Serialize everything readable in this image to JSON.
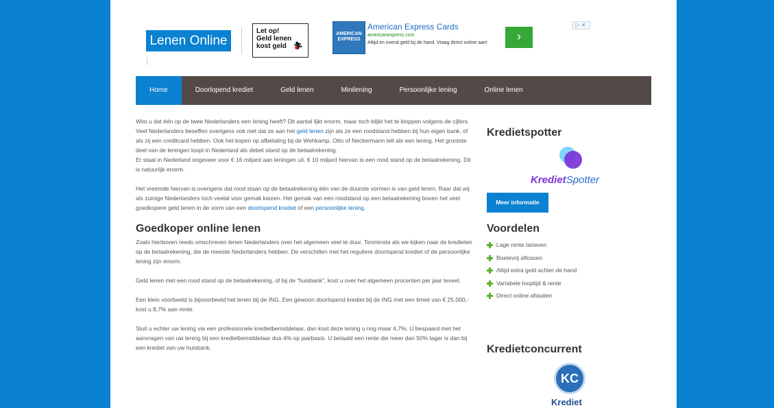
{
  "header": {
    "logo_text": "Lenen Online",
    "warning": {
      "line1": "Let op!",
      "line2": "Geld lenen",
      "line3": "kost geld"
    }
  },
  "ad": {
    "logo_line1": "AMERICAN",
    "logo_line2": "EXPRESS",
    "title": "American Express Cards",
    "url": "americanexpress.com",
    "text": "Altijd en overal geld bij de hand. Vraag direct online aan!",
    "arrow": "›",
    "choices": "▷✕"
  },
  "nav": {
    "items": [
      {
        "label": "Home",
        "active": true
      },
      {
        "label": "Doorlopend krediet"
      },
      {
        "label": "Geld lenen"
      },
      {
        "label": "Minilening"
      },
      {
        "label": "Persoonlijke lening"
      },
      {
        "label": "Online lenen"
      }
    ]
  },
  "main": {
    "p1": {
      "t1": "Wist u dat één op de twee Nederlanders een lening heeft? Dit aantal lijkt enorm, maar toch blijkt het te kloppen volgens de cijfers. Veel Nederlanders beseffen overigens ook niet dat ze aan het ",
      "link1": "geld lenen",
      "t2": " zijn als ze een roodstand hebben bij hun eigen bank, of als zij een creditcard hebben. Ook het kopen op afbetaling bij de Wehkamp, Otto of Neckermann telt als een lening. Het grootste deel van de leningen loopt in Nederland als debet stand op de betaalrekening."
    },
    "p2": "Er staat in Nederland ongeveer voor € 16 miljard aan leningen uit. € 10 miljard hiervan is een rood stand op de betaalrekening. Dit is natuurlijk enorm.",
    "p3": {
      "t1": "Het vreemde hiervan is overigens dat rood staan op de betaalrekening één van de duurste vormen is van geld lenen. Raar dat wij als zuinige Nederlanders toch veelal voor gemak kiezen. Het gemak van een roodstand op een betaalrekening boven het veel goedkopere geld lenen in de vorm van een ",
      "link1": "doorlopend krediet",
      "t2": " of een ",
      "link2": "persoonlijke lening",
      "t3": "."
    },
    "heading": "Goedkoper online lenen",
    "p4": "Zoals hierboven reeds omschreven lenen Nederlanders over het algemeen veel te duur. Tenminste als we kijken naar de kredieten op de betaalrekening, die de meeste Nederlanders hebben. De verschillen met het reguliere doorlopend krediet of de persoonlijke lening zijn enorm.",
    "p5": "Geld lenen met een rood stand op de betaalrekening, of bij de “huisbank”, kost u over het algemeen procenten per jaar teveel.",
    "p6": "Een klein voorbeeld is bijvoorbeeld het lenen bij de ING. Een gewoon doorlopend krediet bij de ING met een limiet van € 25.000,- kost u 8,7% aan rente.",
    "p7": "Sluit u echter uw lening via een professionele kredietbemiddelaar, dan kost deze lening u nog maar 4,7%. U bespaard met het aanvragen van uw lening bij een kredietbemiddelaar dus 4% op jaarbasis. U betaald een rente die meer dan 50% lager is dan bij een krediet van uw huisbank."
  },
  "sidebar": {
    "kredietspotter": {
      "heading": "Kredietspotter",
      "logo_part1": "Krediet",
      "logo_part2": "Spotter",
      "button": "Meer informatie"
    },
    "voordelen": {
      "heading": "Voordelen",
      "items": [
        "Lage rente tarieven",
        "Boetevrij aflossen",
        "Altijd extra geld achter de hand",
        "Variabele looptijd & rente",
        "Direct online afsluiten"
      ]
    },
    "kredietconcurrent": {
      "heading": "Kredietconcurrent",
      "logo_badge": "KC",
      "logo_word": "Krediet"
    }
  },
  "colors": {
    "page_background": "#0a81d1",
    "nav_background": "#534a47",
    "accent": "#0a81d1",
    "link": "#0a6fc0",
    "plus_icon": "#5cb02a"
  }
}
